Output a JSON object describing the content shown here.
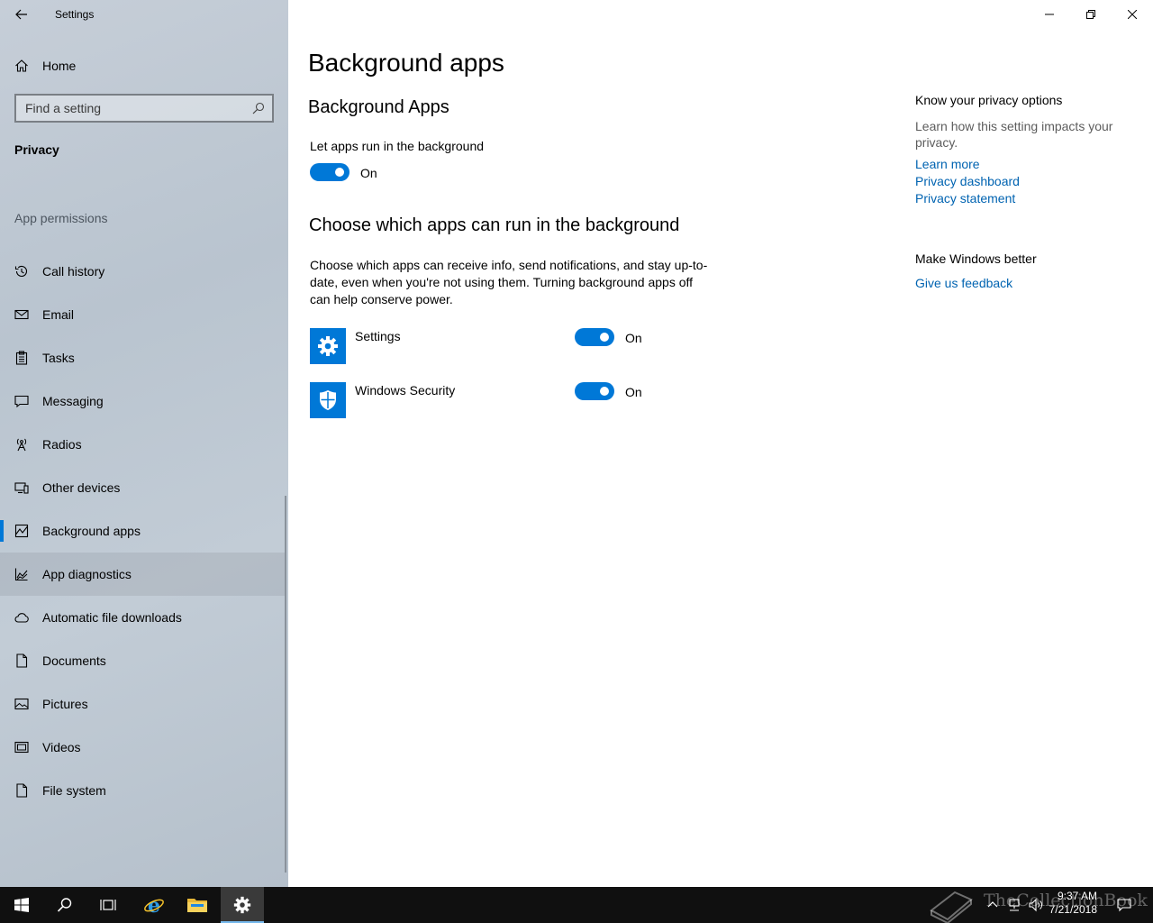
{
  "window": {
    "title": "Settings"
  },
  "sidebar": {
    "home_label": "Home",
    "search_placeholder": "Find a setting",
    "section_title": "Privacy",
    "group_label": "App permissions",
    "items": [
      {
        "label": "Call history",
        "icon": "history-icon"
      },
      {
        "label": "Email",
        "icon": "mail-icon"
      },
      {
        "label": "Tasks",
        "icon": "clipboard-icon"
      },
      {
        "label": "Messaging",
        "icon": "chat-icon"
      },
      {
        "label": "Radios",
        "icon": "antenna-icon"
      },
      {
        "label": "Other devices",
        "icon": "devices-icon"
      },
      {
        "label": "Background apps",
        "icon": "background-apps-icon",
        "selected": true
      },
      {
        "label": "App diagnostics",
        "icon": "diagnostics-icon",
        "hovered": true
      },
      {
        "label": "Automatic file downloads",
        "icon": "cloud-icon"
      },
      {
        "label": "Documents",
        "icon": "document-icon"
      },
      {
        "label": "Pictures",
        "icon": "picture-icon"
      },
      {
        "label": "Videos",
        "icon": "video-icon"
      },
      {
        "label": "File system",
        "icon": "file-icon"
      }
    ]
  },
  "main": {
    "page_title": "Background apps",
    "section1_title": "Background Apps",
    "let_apps_label": "Let apps run in the background",
    "let_apps_state": "On",
    "section2_title": "Choose which apps can run in the background",
    "section2_desc": "Choose which apps can receive info, send notifications, and stay up-to-date, even when you're not using them. Turning background apps off can help conserve power.",
    "apps": [
      {
        "name": "Settings",
        "state": "On",
        "icon": "gear-icon"
      },
      {
        "name": "Windows Security",
        "state": "On",
        "icon": "shield-icon"
      }
    ]
  },
  "right_panel": {
    "privacy_heading": "Know your privacy options",
    "privacy_text": "Learn how this setting impacts your privacy.",
    "links": [
      "Learn more",
      "Privacy dashboard",
      "Privacy statement"
    ],
    "feedback_heading": "Make Windows better",
    "feedback_link": "Give us feedback"
  },
  "taskbar": {
    "time": "9:37 AM",
    "date": "7/21/2018",
    "watermark": "TheCollectionBook"
  },
  "colors": {
    "accent": "#0078d7",
    "link": "#0063b1",
    "taskbar": "#101010"
  }
}
